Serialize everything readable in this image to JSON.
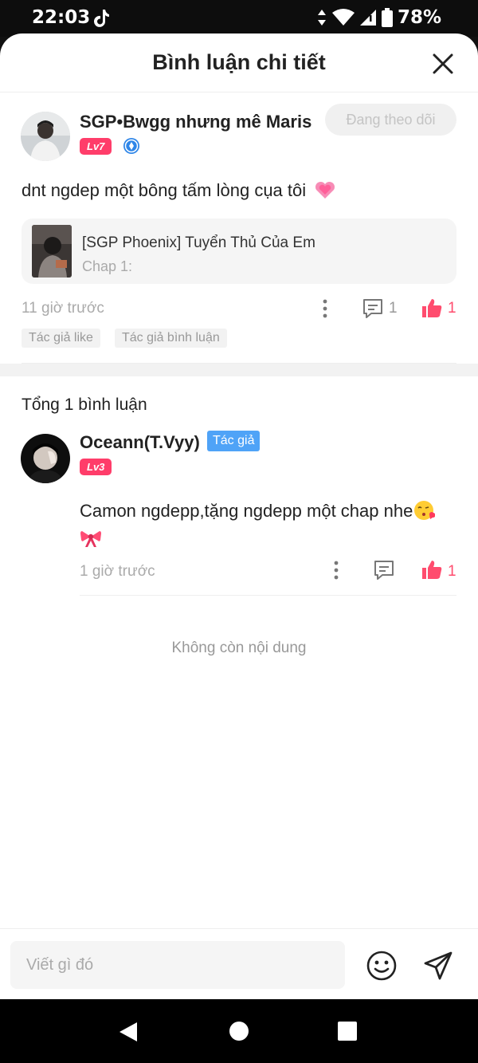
{
  "status_bar": {
    "time": "22:03",
    "battery_pct": "78%"
  },
  "header": {
    "title": "Bình luận chi tiết"
  },
  "main_comment": {
    "username": "SGP•Bwgg nhưng mê Maris",
    "level": "Lv7",
    "follow_label": "Đang theo dõi",
    "text": "dnt ngdep một bông tấm lòng cụa tôi",
    "work": {
      "title": "[SGP Phoenix] Tuyển Thủ Của Em",
      "chapter": "Chap 1:"
    },
    "time": "11 giờ trước",
    "reply_count": "1",
    "like_count": "1",
    "tags": [
      "Tác giả like",
      "Tác giả bình luận"
    ]
  },
  "replies_section": {
    "total_label": "Tổng 1 bình luận",
    "reply": {
      "username": "Oceann(T.Vyy)",
      "author_badge": "Tác giả",
      "level": "Lv3",
      "text": "Camon ngdepp,tặng ngdepp một chap nhe",
      "time": "1 giờ trước",
      "like_count": "1"
    },
    "no_more_label": "Không còn nội dung"
  },
  "input": {
    "placeholder": "Viết gì đó"
  },
  "colors": {
    "accent_pink": "#ff3d6a",
    "author_blue": "#4fa3f7",
    "muted": "#aaaaaa"
  }
}
